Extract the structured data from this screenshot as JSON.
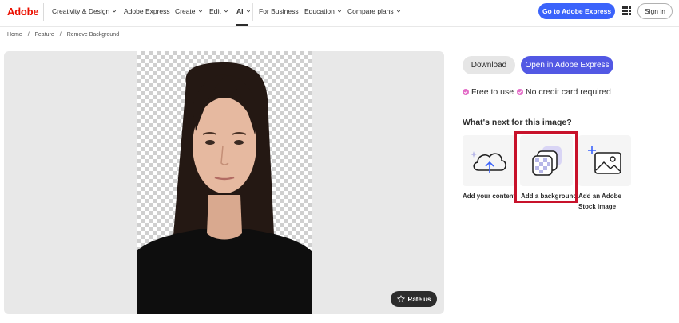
{
  "header": {
    "logo_text": "Adobe",
    "nav": [
      {
        "label": "Creativity & Design",
        "has_chevron": true
      },
      {
        "label": "Adobe Express",
        "has_chevron": false
      },
      {
        "label": "Create",
        "has_chevron": true
      },
      {
        "label": "Edit",
        "has_chevron": true
      },
      {
        "label": "AI",
        "has_chevron": true,
        "active": true
      },
      {
        "label": "For Business",
        "has_chevron": false
      },
      {
        "label": "Education",
        "has_chevron": true
      },
      {
        "label": "Compare plans",
        "has_chevron": true
      }
    ],
    "cta_label": "Go to Adobe Express",
    "apps_icon": "apps-grid-icon",
    "signin_label": "Sign in"
  },
  "breadcrumb": {
    "items": [
      "Home",
      "Feature",
      "Remove Background"
    ],
    "separator": "/"
  },
  "canvas": {
    "rate_label": "Rate us",
    "rate_icon": "star-icon"
  },
  "actions": {
    "download_label": "Download",
    "open_label": "Open in Adobe Express"
  },
  "features": [
    {
      "label": "Free to use",
      "icon": "check-circle-icon"
    },
    {
      "label": "No credit card required",
      "icon": "check-circle-icon"
    }
  ],
  "next_section": {
    "title": "What's next for this image?",
    "cards": [
      {
        "label_line1": "Add your content",
        "label_line2": "",
        "icon": "cloud-upload-icon"
      },
      {
        "label_line1": "Add a background",
        "label_line2": "",
        "icon": "layers-icon",
        "highlighted": true
      },
      {
        "label_line1": "Add an Adobe",
        "label_line2": "Stock image",
        "icon": "add-image-icon"
      }
    ]
  },
  "colors": {
    "brand_red": "#eb1000",
    "primary_blue": "#3b63fb",
    "open_purple": "#5258e4",
    "check_pink": "#e36cc7",
    "highlight_red": "#c8122b"
  }
}
